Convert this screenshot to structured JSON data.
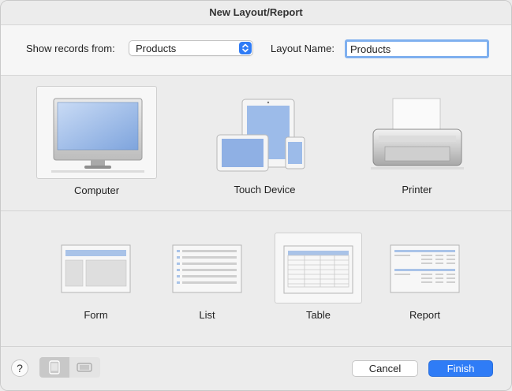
{
  "window": {
    "title": "New Layout/Report"
  },
  "top": {
    "show_records_label": "Show records from:",
    "show_records_value": "Products",
    "layout_name_label": "Layout Name:",
    "layout_name_value": "Products"
  },
  "devices": [
    {
      "label": "Computer",
      "selected": true
    },
    {
      "label": "Touch Device",
      "selected": false
    },
    {
      "label": "Printer",
      "selected": false
    }
  ],
  "layouts": [
    {
      "label": "Form",
      "selected": false
    },
    {
      "label": "List",
      "selected": false
    },
    {
      "label": "Table",
      "selected": true
    },
    {
      "label": "Report",
      "selected": false
    }
  ],
  "footer": {
    "help_label": "?",
    "cancel_label": "Cancel",
    "finish_label": "Finish"
  },
  "colors": {
    "accent": "#2f7cf6",
    "screen_blue": "#8fb3e6"
  }
}
